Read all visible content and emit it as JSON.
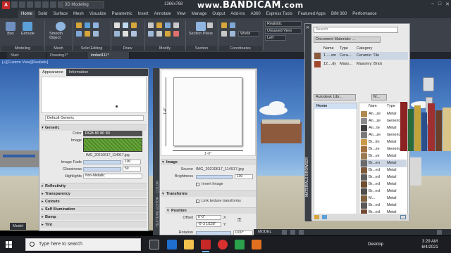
{
  "titlebar": {
    "workspace": "3D Modeling",
    "document": "1366x768",
    "recorder_url": "www.",
    "recorder_brand": "BANDICAM",
    "recorder_tld": ".com"
  },
  "ribbon_tabs": [
    "Home",
    "Solid",
    "Surface",
    "Mesh",
    "Visualize",
    "Parametric",
    "Insert",
    "Annotate",
    "View",
    "Manage",
    "Output",
    "Add-ins",
    "A360",
    "Express Tools",
    "Featured Apps",
    "BIM 360",
    "Performance"
  ],
  "ribbon": {
    "groups": [
      "Modeling",
      "Mesh",
      "Solid Editing",
      "Draw",
      "Modify",
      "Section",
      "Coordinates"
    ],
    "buttons": {
      "box": "Box",
      "extrude": "Extrude",
      "smooth_object": "Smooth Object",
      "section_plane": "Section Plane"
    },
    "visual_style": "Realistic",
    "view_mode": "Unsaved View",
    "view_dir": "Left"
  },
  "file_tabs": [
    "Start",
    "Drawing1*",
    "imdad111*"
  ],
  "viewport_label": "[+][Custom View][Realistic]",
  "materials_editor": {
    "tabs": [
      "Appearance",
      "Information"
    ],
    "material_name": "Default Generic",
    "sections": [
      "Generic",
      "Reflectivity",
      "Transparency",
      "Cutouts",
      "Self Illumination",
      "Bump",
      "Tint"
    ],
    "generic": {
      "color_label": "Color",
      "color_value": "RGB 80 80 80",
      "image_label": "Image",
      "image_name": "IMG_20210617_114917.jpg",
      "image_fade_label": "Image Fade",
      "image_fade_value": "100",
      "glossiness_label": "Glossiness",
      "glossiness_value": "50",
      "highlights_label": "Highlights",
      "highlights_value": "Non-Metallic"
    }
  },
  "texture_editor": {
    "side_label": "TEXTURE EDITOR - COLOR",
    "preview_dim_width": "1'-0\"",
    "preview_dim_height": "1'-0\"",
    "image_section": "Image",
    "source_label": "Source",
    "source_value": "IMG_20210617_114917.jpg",
    "brightness_label": "Brightness",
    "brightness_value": "100",
    "invert_label": "Invert Image",
    "transforms_section": "Transforms",
    "link_label": "Link texture transforms",
    "position_section": "Position",
    "offset_label": "Offset",
    "offset_x": "0'-0\"",
    "offset_y": "-0'-3 1/128\"",
    "offset_x_axis": "X",
    "offset_y_axis": "Y",
    "rotation_label": "Rotation",
    "rotation_value": "0.00°"
  },
  "materials_browser": {
    "side_label": "MATERIALS BROWSER",
    "search_placeholder": "Search",
    "doc_materials": "Document Materials: ...",
    "columns": [
      "Name",
      "Type",
      "Category"
    ],
    "doc_rows": [
      {
        "name": "1.....sm",
        "type": "Cera...",
        "category": "Ceramic: Tile"
      },
      {
        "name": "12....dy",
        "type": "Maso...",
        "category": "Masonry: Brick"
      }
    ],
    "library": "Autodesk Libr...",
    "library_menu": "M...",
    "tree_home": "Home",
    "list_columns": [
      "Nam",
      "Type"
    ],
    "items": [
      {
        "name": "An...ze",
        "type": "Metal"
      },
      {
        "name": "An...ze",
        "type": "Generic"
      },
      {
        "name": "An...te",
        "type": "Metal"
      },
      {
        "name": "An...ze",
        "type": "Generic"
      },
      {
        "name": "Br...tin",
        "type": "Metal"
      },
      {
        "name": "Br...ze",
        "type": "Generic"
      },
      {
        "name": "Br...ye",
        "type": "Metal"
      },
      {
        "name": "Br...en",
        "type": "Metal"
      },
      {
        "name": "Br...ed",
        "type": "Metal"
      },
      {
        "name": "Br...ed",
        "type": "Metal"
      },
      {
        "name": "Br...ed",
        "type": "Metal"
      },
      {
        "name": "Br...ed",
        "type": "Metal"
      },
      {
        "name": "M...",
        "type": "Metal"
      },
      {
        "name": "Br...ed",
        "type": "Metal"
      },
      {
        "name": "Br...ed",
        "type": "Metal"
      },
      {
        "name": "Br...ed",
        "type": "Metal"
      }
    ],
    "selected_index": 7
  },
  "statusbar": {
    "model_tab": "Model",
    "model_label": "MODEL"
  },
  "taskbar": {
    "search_placeholder": "Type here to search",
    "desktop_label": "Desktop",
    "time": "3:29 AM",
    "date": "6/4/2021"
  },
  "colors": {
    "ribbon_bg": "#3d424a",
    "sky_top": "#2f5da8",
    "autocad_red": "#c62828",
    "selection": "#cdd6e3"
  }
}
